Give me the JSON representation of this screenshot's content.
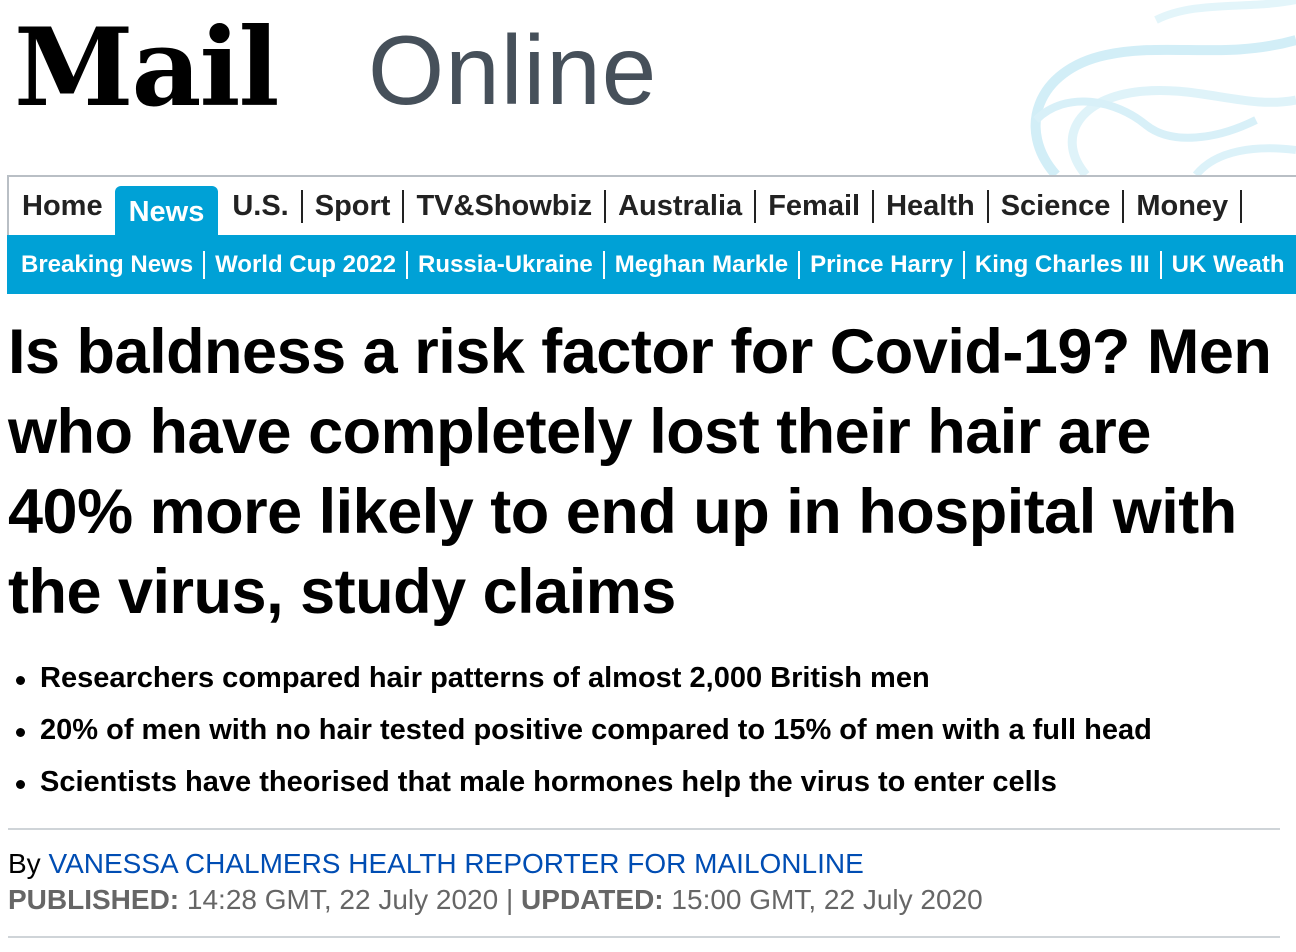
{
  "logo": {
    "mail": "Mail",
    "online": "Online"
  },
  "nav_primary": [
    "Home",
    "News",
    "U.S.",
    "Sport",
    "TV&Showbiz",
    "Australia",
    "Femail",
    "Health",
    "Science",
    "Money"
  ],
  "nav_primary_active": "News",
  "nav_secondary": [
    "Breaking News",
    "World Cup 2022",
    "Russia-Ukraine",
    "Meghan Markle",
    "Prince Harry",
    "King Charles III",
    "UK Weath"
  ],
  "article": {
    "headline": "Is baldness a risk factor for Covid-19? Men who have completely lost their hair are 40% more likely to end up in hospital with the virus, study claims",
    "bullets": [
      "Researchers compared hair patterns of almost 2,000 British men",
      "20% of men with no hair tested positive compared to 15% of men with a full head",
      "Scientists have theorised that male hormones help the virus to enter cells"
    ],
    "byline_prefix": "By",
    "author": "VANESSA CHALMERS HEALTH REPORTER FOR MAILONLINE",
    "published_label": "PUBLISHED:",
    "published_value": "14:28 GMT, 22 July 2020",
    "separator": "|",
    "updated_label": "UPDATED:",
    "updated_value": "15:00 GMT, 22 July 2020"
  },
  "colors": {
    "accent": "#00a1d6",
    "author_link": "#004db3",
    "date_text": "#666666",
    "online_text": "#46505a"
  }
}
